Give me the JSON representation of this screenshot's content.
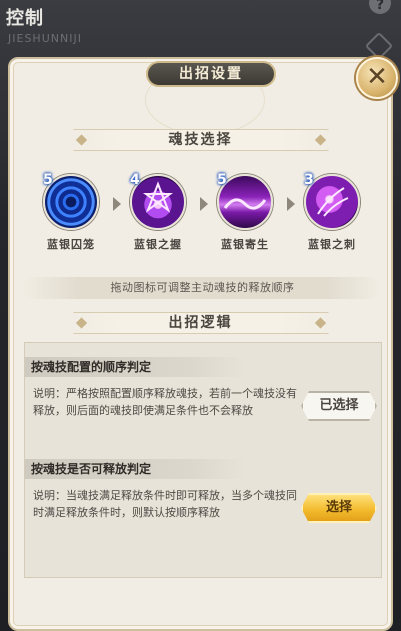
{
  "background": {
    "title": "控制",
    "subtitle": "JIESHUNNIJI"
  },
  "dialog": {
    "title": "出招设置",
    "close_icon": "close-x-icon",
    "skill_section_title": "魂技选择",
    "skills": [
      {
        "name": "蓝银囚笼",
        "level": "5",
        "icon": "blue-web-orb-icon",
        "color": "#1f5ad8"
      },
      {
        "name": "蓝银之握",
        "level": "4",
        "icon": "purple-star-hand-icon",
        "color": "#8a2bd6"
      },
      {
        "name": "蓝银寄生",
        "level": "5",
        "icon": "purple-wave-icon",
        "color": "#a52fc9"
      },
      {
        "name": "蓝银之刺",
        "level": "3",
        "icon": "purple-thorn-icon",
        "color": "#b638d8"
      }
    ],
    "hint": "拖动图标可调整主动魂技的释放顺序",
    "logic_section_title": "出招逻辑",
    "options": [
      {
        "title": "按魂技配置的顺序判定",
        "description": "说明：严格按照配置顺序释放魂技，若前一个魂技没有释放，则后面的魂技即使满足条件也不会释放",
        "button_label": "已选择",
        "selected": true
      },
      {
        "title": "按魂技是否可释放判定",
        "description": "说明：当魂技满足释放条件时即可释放，当多个魂技同时满足释放条件时，则默认按顺序释放",
        "button_label": "选择",
        "selected": false
      }
    ]
  }
}
